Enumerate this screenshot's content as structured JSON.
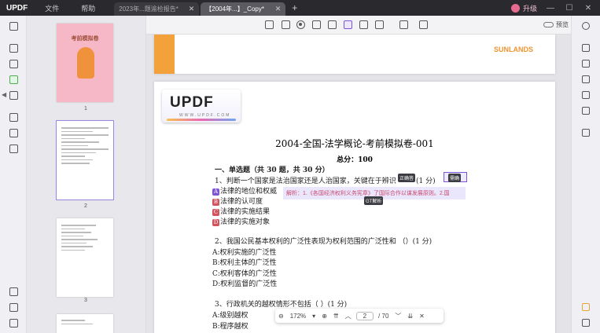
{
  "titlebar": {
    "logo": "UPDF",
    "menu": [
      "文件",
      "帮助"
    ],
    "tabs": [
      {
        "label": "2023年...题渝检报告*",
        "active": false
      },
      {
        "label": "【2004年...】_Copy*",
        "active": true
      }
    ],
    "new_tab": "+",
    "upgrade_label": "升级",
    "window_buttons": [
      "—",
      "☐",
      "✕"
    ]
  },
  "toolbar": {
    "preview_label": "预览"
  },
  "thumbnails": {
    "cover_title": "考前模拟卷",
    "pages": [
      "1",
      "2",
      "3"
    ]
  },
  "doc": {
    "banner_text": "SUNLANDS",
    "logo_text": "UPDF",
    "logo_url": "WWW.UPDF.COM",
    "title": "2004-全国-法学概论-考前模拟卷-001",
    "total": "总分：100",
    "section1": "一、单选题（共 30 题，共 30 分）",
    "q1": "1、判断一个国家是法治国家还是人治国家，关键在于辨识",
    "q1_score": "(1 分)",
    "q1_tag_correct": "正确答",
    "q1_tag_hint": "需确",
    "q1_options": [
      {
        "letter": "A",
        "text": "法律的地位和权威"
      },
      {
        "letter": "B",
        "text": "法律的认可度"
      },
      {
        "letter": "C",
        "text": "法律的实施结果"
      },
      {
        "letter": "D",
        "text": "法律的实施对象"
      }
    ],
    "q1_explain": "解析：1.《各国经济权利义务宪章》了国际合作以谋发展原则。2.国",
    "q1_explain_tag": "GT解析",
    "q2": "2、我国公民基本权利的广泛性表现为权利范围的广泛性和 （）(1 分)",
    "q2_options": [
      "A:权利实施的广泛性",
      "B:权利主体的广泛性",
      "C:权利客体的广泛性",
      "D:权利监督的广泛性"
    ],
    "q3": "3、行政机关的越权情形不包括（ ）(1 分)",
    "q3_options": [
      "A:级别越权",
      "B:程序越权"
    ]
  },
  "navbar": {
    "zoom": "172%",
    "page_current": "2",
    "page_total": "/ 70"
  }
}
